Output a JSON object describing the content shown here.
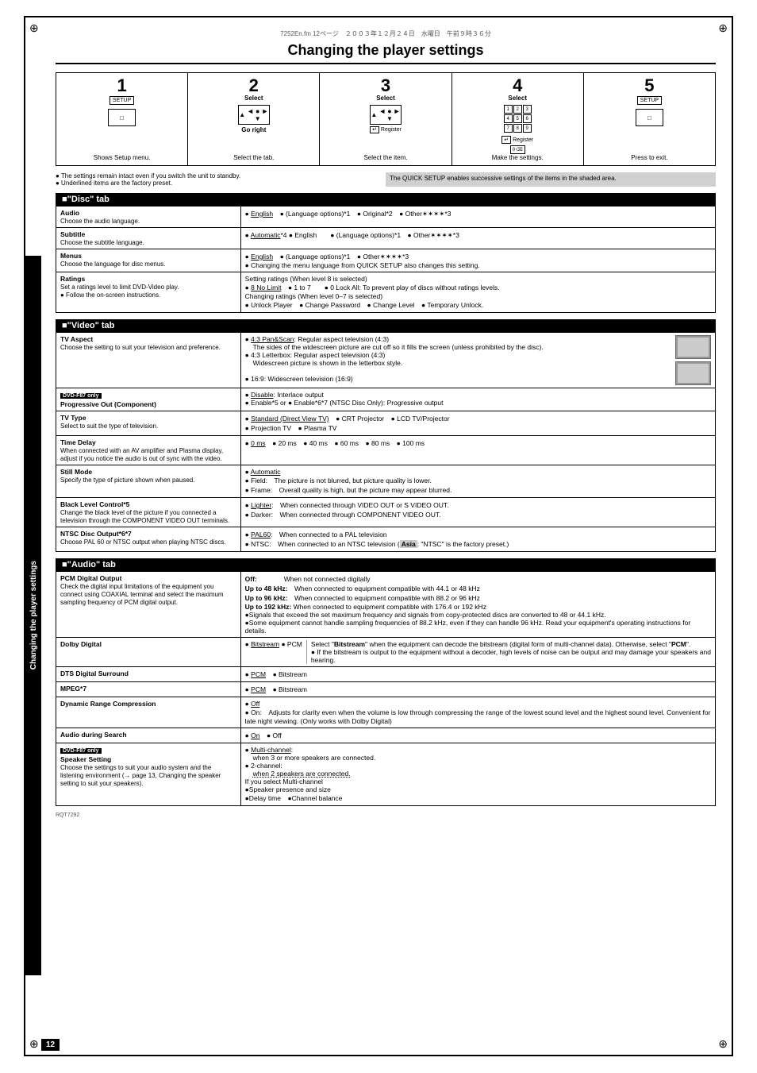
{
  "page": {
    "header_info": "7252En.fm  12ページ　２００３年１２月２４日　水曜日　午前９時３６分",
    "title": "Changing the player settings",
    "page_number": "12",
    "sidebar_text": "Changing the player settings"
  },
  "steps": [
    {
      "number": "1",
      "label": "SETUP",
      "description": "Shows Setup menu."
    },
    {
      "number": "2",
      "label": "Select",
      "sub_label": "Go right",
      "description": "Select the tab."
    },
    {
      "number": "3",
      "label": "Select",
      "sub_label": "Register",
      "description": "Select the item."
    },
    {
      "number": "4",
      "label": "Select",
      "sub_label": "Register",
      "description": "Make the settings."
    },
    {
      "number": "5",
      "label": "SETUP",
      "description": "Press to exit."
    }
  ],
  "notes": {
    "left": [
      "● The settings remain intact even if you switch the unit to standby.",
      "● Underlined items are the factory preset."
    ],
    "right": "The QUICK SETUP enables successive settings of the items in the shaded area."
  },
  "disc_tab": {
    "header": "\"Disc\" tab",
    "rows": [
      {
        "label": "Audio",
        "sub": "Choose the audio language.",
        "value": "● English　● (Language options)*1　● Original*2　● Other✶✶✶✶*3"
      },
      {
        "label": "Subtitle",
        "sub": "Choose the subtitle language.",
        "value": "● Automatic*4 ● English　　● (Language options)*1　● Other✶✶✶✶*3"
      },
      {
        "label": "Menus",
        "sub": "Choose the language for disc menus.",
        "value": "● English　● (Language options)*1　● Other✶✶✶✶*3\n● Changing the menu language from QUICK SETUP also changes this setting."
      },
      {
        "label": "Ratings",
        "sub": "Set a ratings level to limit DVD-Video play.\n● Follow the on-screen instructions.",
        "value": "Setting ratings (When level 8 is selected)\n● 8 No Limit　● 1 to 7　　● 0 Lock All: To prevent play of discs without ratings levels.\nChanging ratings (When level 0–7 is selected)\n● Unlock Player　● Change Password　● Change Level　● Temporary Unlock."
      }
    ]
  },
  "video_tab": {
    "header": "\"Video\" tab",
    "rows": [
      {
        "label": "TV Aspect",
        "sub": "Choose the setting to suit your television and preference.",
        "value": "● 4:3 Pan&Scan: Regular aspect television (4:3)\n  The sides of the widescreen picture are cut off so it fills the screen (unless prohibited by the disc).\n● 4:3 Letterbox: Regular aspect television (4:3)\n  Widescreen picture is shown in the letterbox style.\n● 16:9: Widescreen television (16:9)"
      },
      {
        "label": "Progressive Out (Component)",
        "sub": "DVD-F87 only",
        "value": "● Disable: Interlace output\n● Enable*5 or  ● Enable*6*7 (NTSC Disc Only): Progressive output"
      },
      {
        "label": "TV Type",
        "sub": "Select to suit the type of television.",
        "value": "● Standard (Direct View TV)　● CRT Projector　● LCD TV/Projector\n● Projection TV　● Plasma TV"
      },
      {
        "label": "Time Delay",
        "sub": "When connected with an AV amplifier and Plasma display, adjust if you notice the audio is out of sync with the video.",
        "value": "● 0 ms　● 20 ms　● 40 ms　● 60 ms　● 80 ms　● 100 ms"
      },
      {
        "label": "Still Mode",
        "sub": "Specify the type of picture shown when paused.",
        "value": "● Automatic\n● Field:   The picture is not blurred, but picture quality is lower.\n● Frame:  Overall quality is high, but the picture may appear blurred."
      },
      {
        "label": "Black Level Control*5",
        "sub": "Change the black level of the picture if you connected a television through the COMPONENT VIDEO OUT terminals.",
        "value": "● Lighter:  When connected through VIDEO OUT or S VIDEO OUT.\n● Darker:   When connected through COMPONENT VIDEO OUT."
      },
      {
        "label": "NTSC Disc Output*6*7",
        "sub": "Choose PAL 60 or NTSC output when playing NTSC discs.",
        "value": "● PAL60:  When connected to a PAL television\n● NTSC:  When connected to an NTSC television (Asia: \"NTSC\" is the factory preset.)"
      }
    ]
  },
  "audio_tab": {
    "header": "\"Audio\" tab",
    "rows": [
      {
        "label": "PCM Digital Output",
        "sub": "Check the digital input limitations of the equipment you connect using COAXIAL terminal and select the maximum sampling frequency of PCM digital output.",
        "value": "Off:         When not connected digitally\nUp to 48 kHz:   When connected to equipment compatible with 44.1 or 48 kHz\nUp to 96 kHz:   When connected to equipment compatible with 88.2 or 96 kHz\nUp to 192 kHz:  When connected to equipment compatible with 176.4 or 192 kHz\n●Signals that exceed the set maximum frequency and signals from copy-protected discs are converted to 48 or 44.1 kHz.\n●Some equipment cannot handle sampling frequencies of 88.2 kHz, even if they can handle 96 kHz. Read your equipment's operating instructions for details."
      },
      {
        "label": "Dolby Digital",
        "value": "● Bitstream ● PCM　　Select \"Bitstream\" when the equipment can decode the bitstream (digital form of multi-channel data). Otherwise, select \"PCM\".\n● If the bitstream is output to the equipment without a decoder, high levels of noise can be output and may damage your speakers and hearing."
      },
      {
        "label": "DTS Digital Surround",
        "value": "● PCM　● Bitstream"
      },
      {
        "label": "MPEG*7",
        "value": "● PCM　● Bitstream"
      },
      {
        "label": "Dynamic Range Compression",
        "value": "● Off\n● On:  Adjusts for clarity even when the volume is low through compressing the range of the lowest sound level and the highest sound level. Convenient for late night viewing. (Only works with Dolby Digital)"
      },
      {
        "label": "Audio during Search",
        "value": "● On　● Off"
      },
      {
        "label": "Speaker Setting",
        "sub": "DVD-F87 only\nChoose the settings to suit your audio system and the listening environment (→ page 13, Changing the speaker setting to suit your speakers).",
        "value": "● Multi-channel:\n  when 3 or more speakers are connected.\n● 2-channel:\n  when 2 speakers are connected.\nIf you select Multi-channel\n●Speaker presence and size\n●Delay time　●Channel balance"
      }
    ]
  }
}
